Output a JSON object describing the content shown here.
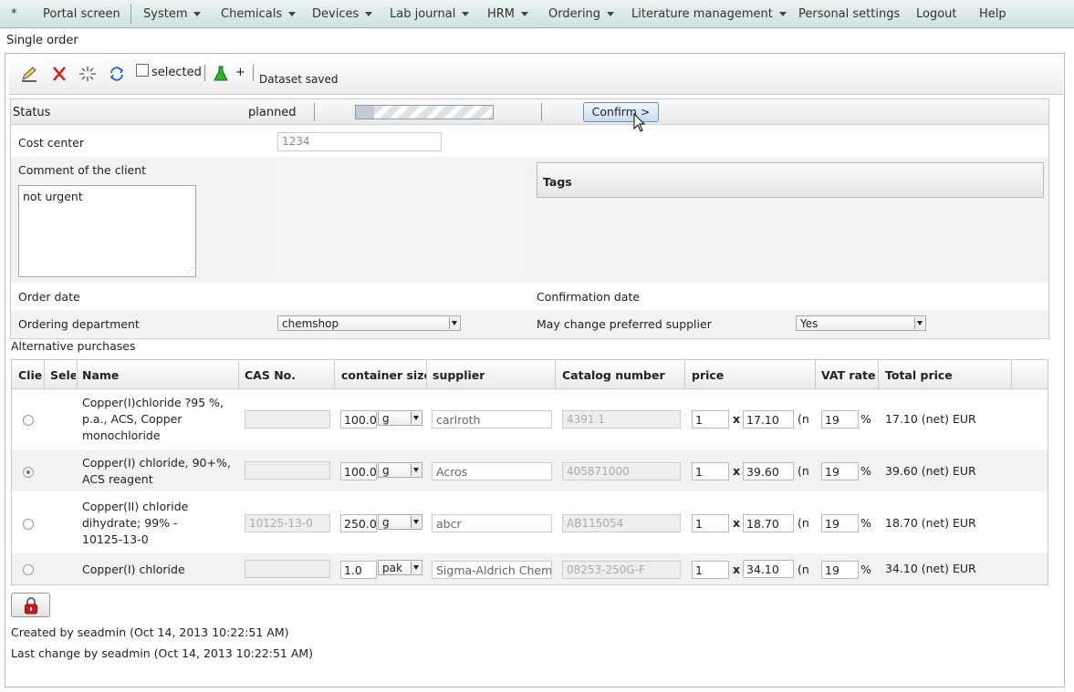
{
  "menu": {
    "items": [
      {
        "label": "*",
        "dropdown": false
      },
      {
        "label": "Portal screen",
        "dropdown": false
      },
      {
        "label": "System",
        "dropdown": true
      },
      {
        "label": "Chemicals",
        "dropdown": true
      },
      {
        "label": "Devices",
        "dropdown": true
      },
      {
        "label": "Lab journal",
        "dropdown": true
      },
      {
        "label": "HRM",
        "dropdown": true
      },
      {
        "label": "Ordering",
        "dropdown": true
      },
      {
        "label": "Literature management",
        "dropdown": true
      },
      {
        "label": "Personal settings",
        "dropdown": false
      },
      {
        "label": "Logout",
        "dropdown": false
      },
      {
        "label": "Help",
        "dropdown": false
      }
    ]
  },
  "page": {
    "title": "Single order"
  },
  "toolbar": {
    "selected_label": "selected",
    "plus_label": "+",
    "status_message": "Dataset saved"
  },
  "status": {
    "label": "Status",
    "value": "planned",
    "confirm_label": "Confirm >"
  },
  "form": {
    "cost_center_label": "Cost center",
    "cost_center_value": "1234",
    "comment_label": "Comment of the client",
    "comment_value": "not urgent",
    "tags_label": "Tags",
    "order_date_label": "Order date",
    "confirmation_date_label": "Confirmation date",
    "ordering_department_label": "Ordering department",
    "ordering_department_value": "chemshop",
    "may_change_supplier_label": "May change preferred supplier",
    "may_change_supplier_value": "Yes"
  },
  "alternatives": {
    "title": "Alternative purchases",
    "columns": [
      "Clie",
      "Sele",
      "Name",
      "CAS No.",
      "container size",
      "supplier",
      "Catalog number",
      "price",
      "VAT rate",
      "Total price"
    ],
    "rows": [
      {
        "selected": false,
        "name": [
          "Copper(I)chloride ?95 %,",
          "p.a., ACS, Copper",
          "monochloride"
        ],
        "cas": "",
        "size": "100.0",
        "unit": "g",
        "supplier": "carlroth",
        "catalog": "4391.1",
        "qty": "1",
        "x": "x",
        "price": "17.10",
        "net_abbr": "(n",
        "vat": "19",
        "pct": "%",
        "total": "17.10 (net) EUR"
      },
      {
        "selected": true,
        "name": [
          "Copper(I) chloride, 90+%,",
          "ACS reagent"
        ],
        "cas": "",
        "size": "100.0",
        "unit": "g",
        "supplier": "Acros",
        "catalog": "405871000",
        "qty": "1",
        "x": "x",
        "price": "39.60",
        "net_abbr": "(n",
        "vat": "19",
        "pct": "%",
        "total": "39.60 (net) EUR"
      },
      {
        "selected": false,
        "name": [
          "Copper(II) chloride",
          "dihydrate; 99% -",
          "10125-13-0"
        ],
        "cas": "10125-13-0",
        "size": "250.0",
        "unit": "g",
        "supplier": "abcr",
        "catalog": "AB115054",
        "qty": "1",
        "x": "x",
        "price": "18.70",
        "net_abbr": "(n",
        "vat": "19",
        "pct": "%",
        "total": "18.70 (net) EUR"
      },
      {
        "selected": false,
        "name": [
          "Copper(I) chloride"
        ],
        "cas": "",
        "size": "1.0",
        "unit": "pak",
        "supplier": "Sigma-Aldrich Chemie",
        "catalog": "08253-250G-F",
        "qty": "1",
        "x": "x",
        "price": "34.10",
        "net_abbr": "(n",
        "vat": "19",
        "pct": "%",
        "total": "34.10 (net) EUR"
      }
    ]
  },
  "footer": {
    "created": "Created by seadmin (Oct 14, 2013 10:22:51 AM)",
    "last_change": "Last change by seadmin (Oct 14, 2013 10:22:51 AM)"
  },
  "colors": {
    "menu_bg": "#d8e8e6",
    "confirm_bg": "#dde8f5",
    "flask_green": "#2bb52b",
    "delete_red": "#e01010",
    "refresh_blue": "#1f5fd6",
    "lock_red": "#d01818"
  }
}
